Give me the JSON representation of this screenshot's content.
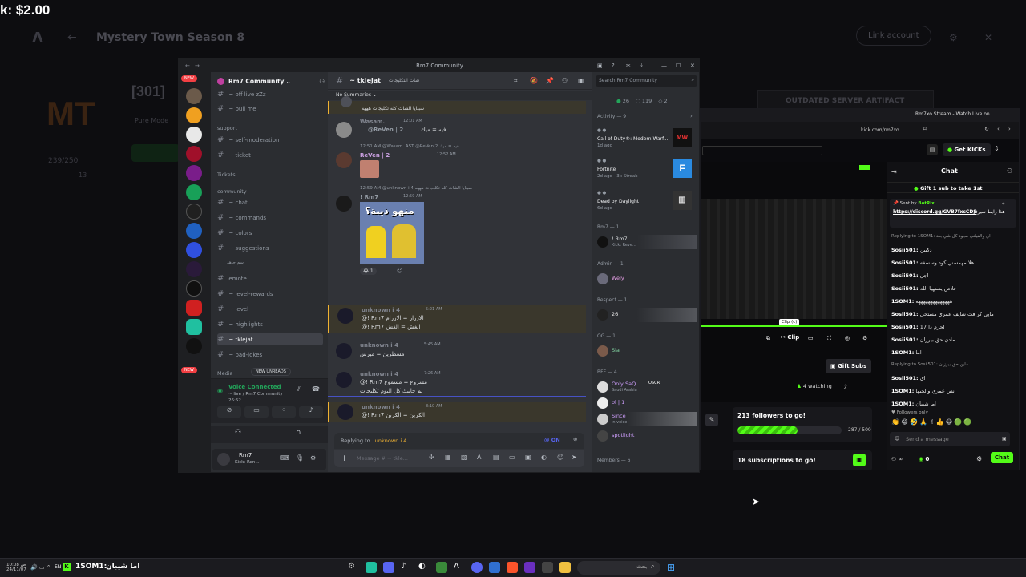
{
  "overlay": {
    "price": "k: $2.00"
  },
  "bgapp": {
    "title": "Mystery Town Season 8",
    "link_account": "Link account",
    "server_name": "[301]",
    "players": "239/250",
    "pure_mode": "Pure Mode",
    "artifact": "OUTDATED SERVER ARTIFACT",
    "count": "13"
  },
  "discord": {
    "window_title": "Rm7 Community",
    "server_name": "Rm7 Community",
    "new_badge": "NEW",
    "channels": {
      "off_live": "~ off live zZz",
      "pull_me": "~ pull me",
      "support_cat": "support",
      "self_moderation": "~ self-moderation",
      "ticket": "~ ticket",
      "tickets_cat": "Tickets",
      "community_cat": "community",
      "chat": "~ chat",
      "commands": "~ commands",
      "colors": "~ colors",
      "suggestions": "~ suggestions",
      "sub": "اسم جاهد",
      "emote": "emote",
      "level_rewards": "~ level-rewards",
      "level": "~ level",
      "highlights": "~ highlights",
      "tklejat": "~ tklejat",
      "bad_jokes": "~ bad-jokes",
      "media_cat": "Media",
      "new_unreads": "NEW UNREADS"
    },
    "voice": {
      "status": "Voice Connected",
      "channel": "~ live / Rm7 Community",
      "time": "26:52"
    },
    "user": {
      "name": "! Rm7",
      "status": "Kick: Ren..."
    },
    "header": {
      "channel": "~ tklejat",
      "topic": "شات التكليجات",
      "summaries": "No Summaries",
      "search": "Search Rm7 Community"
    },
    "messages": [
      {
        "user": "",
        "time": "",
        "text": "سبنايا الشات كله تكليجات هههه"
      },
      {
        "user": "Wasam.",
        "tag": "AST",
        "time": "12:01 AM",
        "reply": "@ReVen | 2",
        "text": "فيه = ميك"
      },
      {
        "user": "ReVen | 2",
        "tag": "OFA",
        "time": "12:52 AM",
        "reply": "12:51 AM  @Wasam. AST  @ReVen|2  فيه = ميك",
        "text": ""
      },
      {
        "user": "! Rm7",
        "time": "12:59 AM",
        "reply": "12:59 AM  @unknown i 4  سبنايا الشات كله تكليجات هههه",
        "text": "",
        "meme": "منهو ذيبة؟",
        "reactions": "1"
      },
      {
        "user": "unknown i 4",
        "time": "5:21 AM",
        "line1": "@! Rm7  الازرار = الازرام",
        "line2": "@! Rm7  الغش = الغش"
      },
      {
        "user": "unknown i 4",
        "time": "5:45 AM",
        "line1": "مسطرين = ميزس"
      },
      {
        "user": "unknown i 4",
        "time": "7:26 AM",
        "line1": "@! Rm7  مشروع = مشموع",
        "line2": "لم حابيك كل اليوم تكليجات"
      },
      {
        "user": "unknown i 4",
        "time": "8:10 AM",
        "line1": "@! Rm7  الكرين = الكربن"
      }
    ],
    "reply_bar": {
      "label": "Replying to",
      "user": "unknown i 4",
      "on": "@ ON"
    },
    "input_placeholder": "Message # ~ tkle...",
    "members": {
      "online": "26",
      "total": "119",
      "count": "2",
      "activity": "Activity — 9",
      "activities": [
        {
          "game": "Call of Duty®: Modern Warf...",
          "time": "1d ago"
        },
        {
          "game": "Fortnite",
          "time": "2d ago · 3x Streak"
        },
        {
          "game": "Dead by Daylight",
          "time": "6d ago"
        }
      ],
      "rm7_role": "Rm7 — 1",
      "rm7_name": "! Rm7",
      "rm7_status": "Kick: Reve...",
      "admin_role": "Admin — 1",
      "admin_name": "Wely",
      "respect_role": "Respect — 1",
      "respect_name": "26",
      "og_role": "OG — 1",
      "og_name": "Sla",
      "bff_role": "BFF — 4",
      "bff1": "Only SaQ",
      "bff1_tag": "OSCR",
      "bff1_status": "Saudi Arabia",
      "bff2": "ol | 1",
      "bff3": "Since",
      "bff3_status": "in voice",
      "bff4": "spotlight",
      "members_role": "Members — 6"
    }
  },
  "kick": {
    "tab": "Rm7xo Stream - Watch Live on ...",
    "url": "kick.com/rm7xo",
    "get_kicks": "Get KICKs",
    "chat_title": "Chat",
    "gift_banner": "Gift 1 sub to take 1st",
    "pinned_by": "Sent by",
    "pinned_user": "BotRix",
    "pinned_link": "https://discord.gg/GVB7fxcCD8",
    "pinned_text": "هذا رابط سيرفرنا",
    "chat": [
      {
        "user": "",
        "text": "Replying to 1SOM1: اي والفيلني مجود كل شي بعد"
      },
      {
        "user": "Sosii501:",
        "text": "دكيين"
      },
      {
        "user": "Sosii501:",
        "text": "هلا مهمسني كود وسسفه"
      },
      {
        "user": "Sosii501:",
        "text": "اجل"
      },
      {
        "user": "Sosii501:",
        "text": "خلاص يستهيا الله"
      },
      {
        "user": "1SOM1:",
        "text": "ههههههههههههههه"
      },
      {
        "user": "Sosii501:",
        "text": "مايى كرافت شايف عمري مستحي"
      },
      {
        "user": "Sosii501:",
        "text": "لحرم دا 17"
      },
      {
        "user": "Sosii501:",
        "text": "مادن حق بيرزان"
      },
      {
        "user": "1SOM1:",
        "text": "اما"
      },
      {
        "user": "",
        "text": "Replying to Sosii501: ماين حق بيرزان"
      },
      {
        "user": "Sosii501:",
        "text": "اي"
      },
      {
        "user": "1SOM1:",
        "text": "نص عمري والحيها"
      },
      {
        "user": "1SOM1:",
        "text": "اما شيبان"
      }
    ],
    "followers_only": "Followers only",
    "send_placeholder": "Send a message",
    "kicks_count": "0",
    "chat_btn": "Chat",
    "clip_tooltip": "Clip (c)",
    "clip_label": "Clip",
    "gift_subs": "Gift Subs",
    "watching": "4 watching",
    "followers_goal": "213 followers to go!",
    "followers_progress": "287 / 500",
    "followers_fraction": 0.574,
    "subs_goal": "18 subscriptions to go!"
  },
  "taskbar": {
    "lang": "EN",
    "time": "ص 10:08",
    "date": "24/11/07",
    "pinned_text": "1SOM1:",
    "pinned_msg": "اما شيبان",
    "search": "بحث"
  }
}
